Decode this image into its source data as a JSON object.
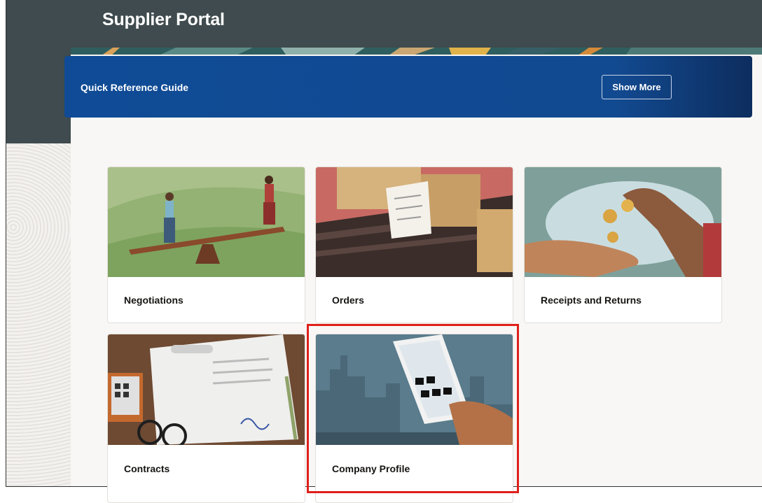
{
  "header": {
    "title": "Supplier Portal"
  },
  "quick_reference": {
    "title": "Quick Reference Guide",
    "button_label": "Show More"
  },
  "cards": [
    {
      "label": "Negotiations"
    },
    {
      "label": "Orders"
    },
    {
      "label": "Receipts and Returns"
    },
    {
      "label": "Contracts"
    },
    {
      "label": "Company Profile"
    }
  ],
  "colors": {
    "header_band": "#3f4b4e",
    "banner_blue": "#124a91",
    "highlight_red": "#e0201a"
  }
}
